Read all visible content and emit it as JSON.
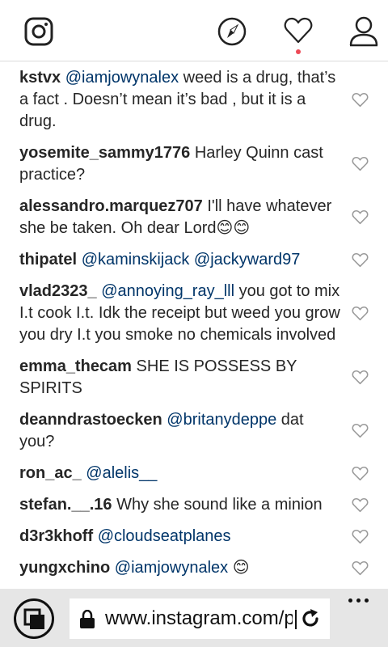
{
  "topbar": {
    "logo_icon": "instagram-logo-icon",
    "explore_icon": "compass-icon",
    "activity_icon": "heart-icon",
    "profile_icon": "person-icon",
    "notification_color": "#ed4956"
  },
  "comments": [
    {
      "user": "kstvx",
      "mention": "@iamjowynalex",
      "text": " weed is a drug, that’s a fact . Doesn’t mean it’s bad , but it is a drug."
    },
    {
      "user": "yosemite_sammy1776",
      "mention": "",
      "text": " Harley Quinn cast practice?"
    },
    {
      "user": "alessandro.marquez707",
      "mention": "",
      "text": " I'll have whatever she be taken. Oh dear Lord😊😊"
    },
    {
      "user": "thipatel",
      "mention": "@kaminskijack @jackyward97",
      "text": ""
    },
    {
      "user": "vlad2323_",
      "mention": "@annoying_ray_lll",
      "text": " you got to mix I.t cook I.t. Idk the receipt but weed you grow you dry I.t you smoke no chemicals involved"
    },
    {
      "user": "emma_thecam",
      "mention": "",
      "text": " SHE IS POSSESS BY SPIRITS"
    },
    {
      "user": "deanndrastoecken",
      "mention": "@britanydeppe",
      "text": " dat you?"
    },
    {
      "user": "ron_ac_",
      "mention": "@alelis__",
      "text": ""
    },
    {
      "user": "stefan.__.16",
      "mention": "",
      "text": " Why she sound like a minion"
    },
    {
      "user": "d3r3khoff",
      "mention": "@cloudseatplanes",
      "text": ""
    },
    {
      "user": "yungxchino",
      "mention": "@iamjowynalex",
      "text": " 😊"
    }
  ],
  "browser": {
    "url": "www.instagram.com/p",
    "tabs_icon": "tabs-icon",
    "lock_icon": "lock-icon",
    "reload_icon": "reload-icon",
    "more_icon": "more-dots-icon"
  },
  "colors": {
    "text": "#262626",
    "mention": "#003569",
    "bar": "#e6e6e6"
  }
}
